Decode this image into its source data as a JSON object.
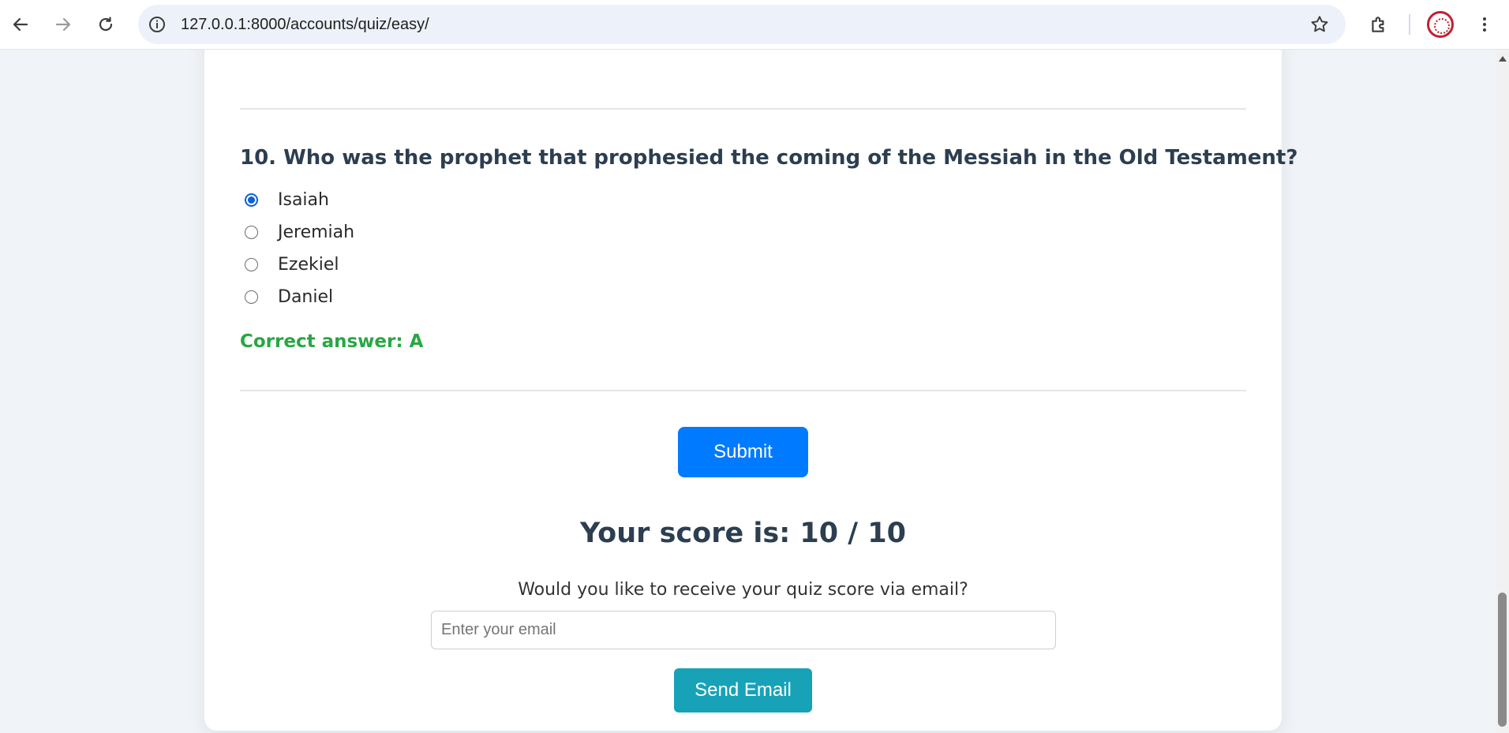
{
  "browser": {
    "url": "127.0.0.1:8000/accounts/quiz/easy/",
    "icons": [
      "back-icon",
      "forward-icon",
      "reload-icon",
      "info-icon",
      "star-icon",
      "extensions-icon",
      "menu-icon"
    ]
  },
  "quiz": {
    "question": "10. Who was the prophet that prophesied the coming of the Messiah in the Old Testament?",
    "options": [
      {
        "label": "Isaiah",
        "checked": true
      },
      {
        "label": "Jeremiah",
        "checked": false
      },
      {
        "label": "Ezekiel",
        "checked": false
      },
      {
        "label": "Daniel",
        "checked": false
      }
    ],
    "correct_answer": "Correct answer: A",
    "submit_label": "Submit",
    "score_text": "Your score is: 10 / 10",
    "email_prompt": "Would you like to receive your quiz score via email?",
    "email_placeholder": "Enter your email",
    "email_value": "",
    "send_label": "Send Email"
  },
  "colors": {
    "primary": "#007bff",
    "success": "#28a745",
    "info": "#17a2b8",
    "heading": "#2c3e50"
  }
}
